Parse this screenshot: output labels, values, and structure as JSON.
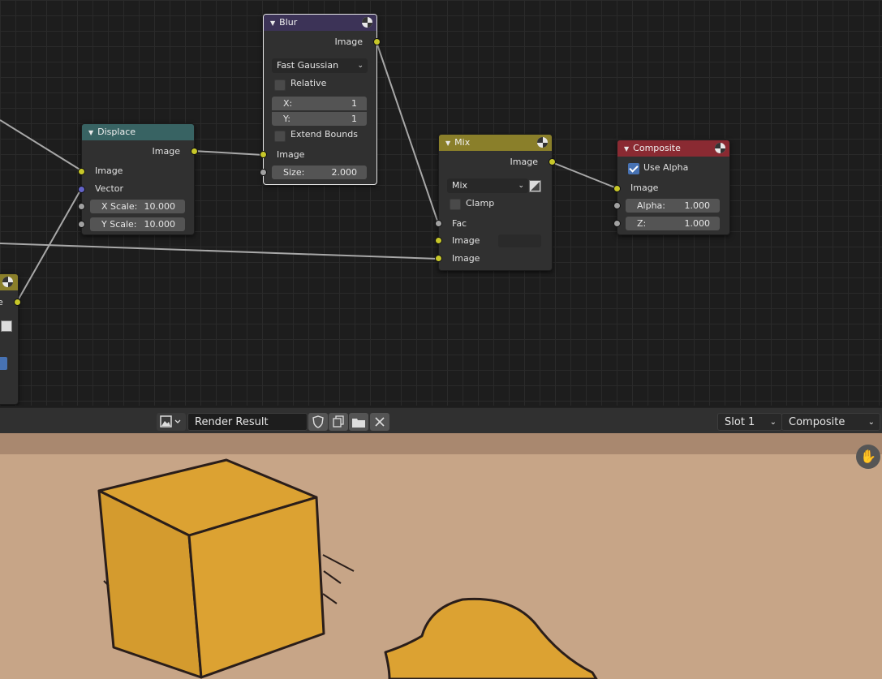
{
  "nodes": {
    "blur": {
      "title": "Blur",
      "output": "Image",
      "filter_type": "Fast Gaussian",
      "relative_label": "Relative",
      "x_label": "X:",
      "x_value": "1",
      "y_label": "Y:",
      "y_value": "1",
      "extend_bounds_label": "Extend Bounds",
      "input_image": "Image",
      "size_label": "Size:",
      "size_value": "2.000",
      "header_color": "#3c3357"
    },
    "displace": {
      "title": "Displace",
      "output": "Image",
      "input_image": "Image",
      "input_vector": "Vector",
      "xscale_label": "X Scale:",
      "xscale_value": "10.000",
      "yscale_label": "Y Scale:",
      "yscale_value": "10.000",
      "header_color": "#386363"
    },
    "mix": {
      "title": "Mix",
      "output": "Image",
      "blend_type": "Mix",
      "clamp_label": "Clamp",
      "fac_label": "Fac",
      "input_image1": "Image",
      "input_image2": "Image",
      "header_color": "#8a7f2a"
    },
    "composite": {
      "title": "Composite",
      "use_alpha_label": "Use Alpha",
      "use_alpha_checked": true,
      "input_image": "Image",
      "alpha_label": "Alpha:",
      "alpha_value": "1.000",
      "z_label": "Z:",
      "z_value": "1.000",
      "header_color": "#8a2a32"
    },
    "partial_left": {
      "output_partial": "e",
      "header_color": "#8a7f2a"
    }
  },
  "image_header": {
    "image_name": "Render Result",
    "slot": "Slot 1",
    "layer": "Composite",
    "icons": [
      "image-editor-icon",
      "fake-user-shield-icon",
      "duplicate-icon",
      "open-folder-icon",
      "close-icon"
    ]
  },
  "colors": {
    "render_bg": "#c7a587",
    "object_yellow": "#dca232",
    "outline": "#2a1e1a"
  }
}
